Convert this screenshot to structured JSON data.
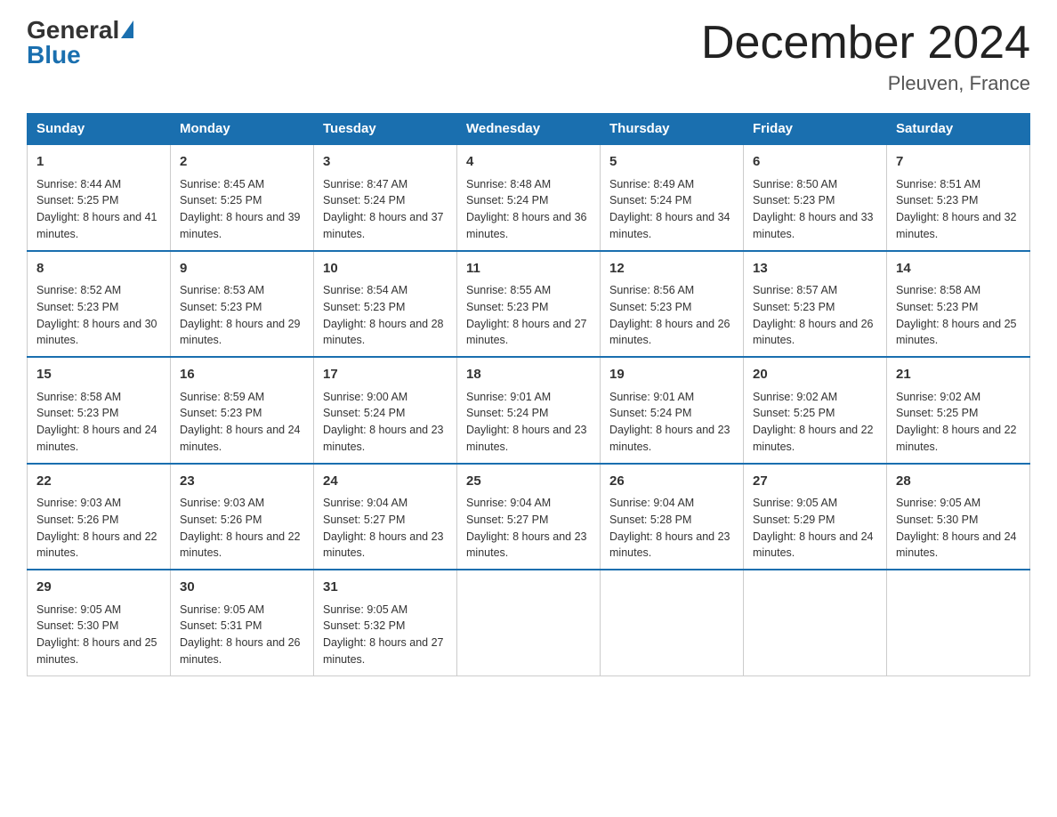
{
  "header": {
    "logo_general": "General",
    "logo_blue": "Blue",
    "title": "December 2024",
    "subtitle": "Pleuven, France"
  },
  "days_of_week": [
    "Sunday",
    "Monday",
    "Tuesday",
    "Wednesday",
    "Thursday",
    "Friday",
    "Saturday"
  ],
  "weeks": [
    [
      {
        "day": "1",
        "sunrise": "8:44 AM",
        "sunset": "5:25 PM",
        "daylight": "8 hours and 41 minutes."
      },
      {
        "day": "2",
        "sunrise": "8:45 AM",
        "sunset": "5:25 PM",
        "daylight": "8 hours and 39 minutes."
      },
      {
        "day": "3",
        "sunrise": "8:47 AM",
        "sunset": "5:24 PM",
        "daylight": "8 hours and 37 minutes."
      },
      {
        "day": "4",
        "sunrise": "8:48 AM",
        "sunset": "5:24 PM",
        "daylight": "8 hours and 36 minutes."
      },
      {
        "day": "5",
        "sunrise": "8:49 AM",
        "sunset": "5:24 PM",
        "daylight": "8 hours and 34 minutes."
      },
      {
        "day": "6",
        "sunrise": "8:50 AM",
        "sunset": "5:23 PM",
        "daylight": "8 hours and 33 minutes."
      },
      {
        "day": "7",
        "sunrise": "8:51 AM",
        "sunset": "5:23 PM",
        "daylight": "8 hours and 32 minutes."
      }
    ],
    [
      {
        "day": "8",
        "sunrise": "8:52 AM",
        "sunset": "5:23 PM",
        "daylight": "8 hours and 30 minutes."
      },
      {
        "day": "9",
        "sunrise": "8:53 AM",
        "sunset": "5:23 PM",
        "daylight": "8 hours and 29 minutes."
      },
      {
        "day": "10",
        "sunrise": "8:54 AM",
        "sunset": "5:23 PM",
        "daylight": "8 hours and 28 minutes."
      },
      {
        "day": "11",
        "sunrise": "8:55 AM",
        "sunset": "5:23 PM",
        "daylight": "8 hours and 27 minutes."
      },
      {
        "day": "12",
        "sunrise": "8:56 AM",
        "sunset": "5:23 PM",
        "daylight": "8 hours and 26 minutes."
      },
      {
        "day": "13",
        "sunrise": "8:57 AM",
        "sunset": "5:23 PM",
        "daylight": "8 hours and 26 minutes."
      },
      {
        "day": "14",
        "sunrise": "8:58 AM",
        "sunset": "5:23 PM",
        "daylight": "8 hours and 25 minutes."
      }
    ],
    [
      {
        "day": "15",
        "sunrise": "8:58 AM",
        "sunset": "5:23 PM",
        "daylight": "8 hours and 24 minutes."
      },
      {
        "day": "16",
        "sunrise": "8:59 AM",
        "sunset": "5:23 PM",
        "daylight": "8 hours and 24 minutes."
      },
      {
        "day": "17",
        "sunrise": "9:00 AM",
        "sunset": "5:24 PM",
        "daylight": "8 hours and 23 minutes."
      },
      {
        "day": "18",
        "sunrise": "9:01 AM",
        "sunset": "5:24 PM",
        "daylight": "8 hours and 23 minutes."
      },
      {
        "day": "19",
        "sunrise": "9:01 AM",
        "sunset": "5:24 PM",
        "daylight": "8 hours and 23 minutes."
      },
      {
        "day": "20",
        "sunrise": "9:02 AM",
        "sunset": "5:25 PM",
        "daylight": "8 hours and 22 minutes."
      },
      {
        "day": "21",
        "sunrise": "9:02 AM",
        "sunset": "5:25 PM",
        "daylight": "8 hours and 22 minutes."
      }
    ],
    [
      {
        "day": "22",
        "sunrise": "9:03 AM",
        "sunset": "5:26 PM",
        "daylight": "8 hours and 22 minutes."
      },
      {
        "day": "23",
        "sunrise": "9:03 AM",
        "sunset": "5:26 PM",
        "daylight": "8 hours and 22 minutes."
      },
      {
        "day": "24",
        "sunrise": "9:04 AM",
        "sunset": "5:27 PM",
        "daylight": "8 hours and 23 minutes."
      },
      {
        "day": "25",
        "sunrise": "9:04 AM",
        "sunset": "5:27 PM",
        "daylight": "8 hours and 23 minutes."
      },
      {
        "day": "26",
        "sunrise": "9:04 AM",
        "sunset": "5:28 PM",
        "daylight": "8 hours and 23 minutes."
      },
      {
        "day": "27",
        "sunrise": "9:05 AM",
        "sunset": "5:29 PM",
        "daylight": "8 hours and 24 minutes."
      },
      {
        "day": "28",
        "sunrise": "9:05 AM",
        "sunset": "5:30 PM",
        "daylight": "8 hours and 24 minutes."
      }
    ],
    [
      {
        "day": "29",
        "sunrise": "9:05 AM",
        "sunset": "5:30 PM",
        "daylight": "8 hours and 25 minutes."
      },
      {
        "day": "30",
        "sunrise": "9:05 AM",
        "sunset": "5:31 PM",
        "daylight": "8 hours and 26 minutes."
      },
      {
        "day": "31",
        "sunrise": "9:05 AM",
        "sunset": "5:32 PM",
        "daylight": "8 hours and 27 minutes."
      },
      null,
      null,
      null,
      null
    ]
  ],
  "labels": {
    "sunrise": "Sunrise:",
    "sunset": "Sunset:",
    "daylight": "Daylight:"
  }
}
